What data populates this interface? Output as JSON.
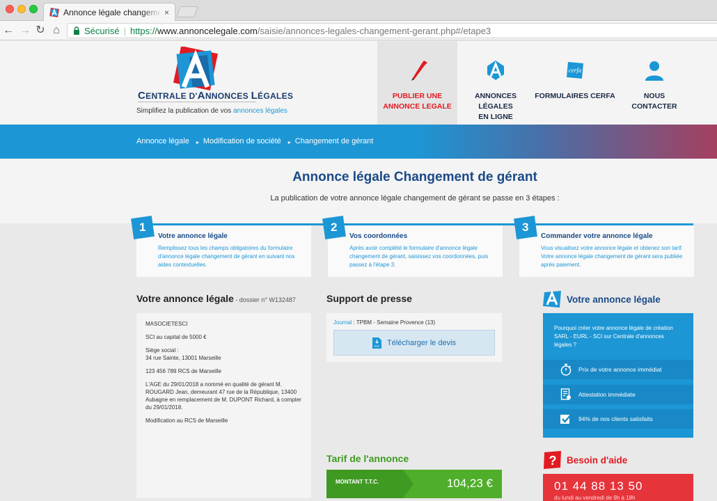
{
  "browser": {
    "tab_title": "Annonce légale changement de gérant",
    "tab_close": "×",
    "secure_label": "Sécurisé",
    "url_scheme": "https://",
    "url_host": "www.annoncelegale.com",
    "url_path": "/saisie/annonces-legales-changement-gerant.php#/etape3"
  },
  "logo": {
    "name_c": "C",
    "name_1": "ENTRALE D'",
    "name_a": "A",
    "name_2": "NNONCES ",
    "name_l": "L",
    "name_3": "ÉGALES",
    "tagline_main": "Simplifiez la publication de vos ",
    "tagline_accent": "annonces légales"
  },
  "nav": [
    {
      "label": "PUBLIER UNE\nANNONCE LEGALE",
      "icon": "pencil-icon",
      "active": true
    },
    {
      "label": "ANNONCES LÉGALES\nEN LIGNE",
      "icon": "annonce-logo-icon"
    },
    {
      "label": "FORMULAIRES CERFA",
      "icon": "cerfa-icon"
    },
    {
      "label": "NOUS\nCONTACTER",
      "icon": "user-icon"
    }
  ],
  "breadcrumb": [
    "Annonce légale",
    "Modification de société",
    "Changement de gérant"
  ],
  "breadcrumb_sep": "▸",
  "intro": {
    "title": "Annonce légale Changement de gérant",
    "subtitle": "La publication de votre annonce légale changement de gérant se passe en 3 étapes :"
  },
  "steps": [
    {
      "number": "1",
      "title": "Votre annonce légale",
      "text": "Remplissez tous les champs obligatoires du formulaire d'annonce légale changement de gérant en suivant nos aides contextuelles."
    },
    {
      "number": "2",
      "title": "Vos coordonnées",
      "text": "Après avoir complété le formulaire d'annonce légale changement de gérant, saisissez vos coordonnées, puis passez à l'étape 3."
    },
    {
      "number": "3",
      "title": "Commander votre annonce légale",
      "text": "Vous visualisez votre annonce légale et obtenez son tarif. Votre annonce légale changement de gérant sera publiée après paiement."
    }
  ],
  "annonce": {
    "heading": "Votre annonce légale",
    "dossier": " - dossier n° W132487",
    "lines": [
      "MASOCIETESCI",
      "SCI au capital de 5000 €",
      "Siège social :\n34 rue Sainte, 13001 Marseille",
      "123 456 789 RCS de Marseille",
      "L'AGE du 29/01/2018 a nommé en qualité de gérant M. ROUGARD Jean, demeurant 47 rue de la République, 13400 Aubagne en remplacement de M. DUPONT Richard, à compter du 29/01/2018.",
      "Modification au RCS de Marseille"
    ]
  },
  "presse": {
    "heading": "Support de presse",
    "journal_label": "Journal",
    "journal_value": " : TPBM - Semaine Provence (13)",
    "download_label": "Télécharger le devis"
  },
  "tarif": {
    "heading": "Tarif de l'annonce",
    "label": "MONTANT T.T.C.",
    "value": "104,23 €"
  },
  "sidebar": {
    "title": "Votre annonce légale",
    "intro": "Pourquoi créer votre annonce légale de création SARL - EURL - SCI sur Centrale d'annonces légales ?",
    "features": [
      {
        "label": "Prix de votre annonce immédiat",
        "icon": "stopwatch-icon"
      },
      {
        "label": "Attestation immédiate",
        "icon": "certificate-icon"
      },
      {
        "label": "94% de nos clients satisfaits",
        "icon": "check-icon"
      }
    ]
  },
  "help": {
    "title": "Besoin d'aide",
    "phone": "01 44 88 13 50",
    "hours": "du lundi au vendredi de 9h à 18h"
  },
  "colors": {
    "brand_blue": "#1c96d5",
    "brand_navy": "#1a4a86",
    "brand_red": "#e11b22",
    "tarif_green": "#4fae2a"
  }
}
